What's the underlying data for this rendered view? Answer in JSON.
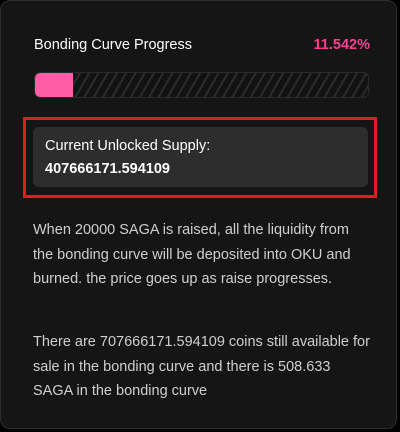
{
  "progress": {
    "title": "Bonding Curve Progress",
    "percent_text": "11.542%",
    "fraction": 0.11542,
    "accent_color": "#ff3e93",
    "fill_color": "#ff5ea6"
  },
  "supply": {
    "label": "Current Unlocked Supply:",
    "value": "407666171.594109",
    "highlight_color": "#e11d24"
  },
  "info": {
    "paragraph1": "When 20000 SAGA is raised, all the liquidity from the bonding curve will be deposited into OKU and burned. the price goes up as raise progresses.",
    "paragraph2": "There are 707666171.594109 coins still available for sale in the bonding curve and there is 508.633 SAGA in the bonding curve"
  }
}
